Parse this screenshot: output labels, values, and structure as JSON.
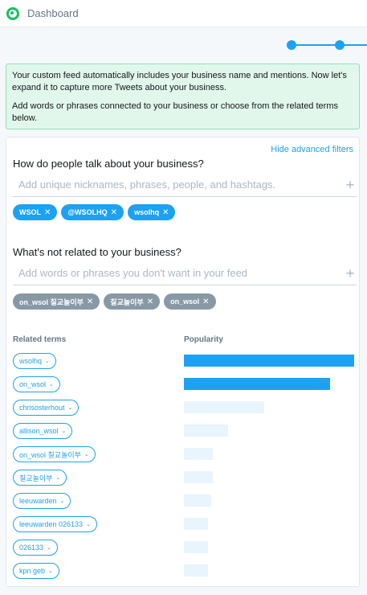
{
  "app": {
    "title": "Dashboard",
    "accent": "#1da1f2",
    "brand": "#17bf63"
  },
  "info": {
    "line1": "Your custom feed automatically includes your business name and mentions. Now let's expand it to capture more Tweets about your business.",
    "line2": "Add words or phrases connected to your business or choose from the related terms below."
  },
  "card": {
    "advanced_link": "Hide advanced filters",
    "include": {
      "question": "How do people talk about your business?",
      "placeholder": "Add unique nicknames, phrases, people, and hashtags.",
      "tags": [
        "WSOL",
        "@WSOLHQ",
        "wsolhq"
      ]
    },
    "exclude": {
      "question": "What's not related to your business?",
      "placeholder": "Add words or phrases you don't want in your feed",
      "tags": [
        "on_wsol 칠교놀이부",
        "칠교놀이부",
        "on_wsol"
      ]
    },
    "related": {
      "terms_header": "Related terms",
      "popularity_header": "Popularity",
      "items": [
        {
          "term": "wsolhq",
          "popularity": 1.0
        },
        {
          "term": "on_wsol",
          "popularity": 0.86
        },
        {
          "term": "chrisosterhout",
          "popularity": 0.47
        },
        {
          "term": "allison_wsol",
          "popularity": 0.26
        },
        {
          "term": "on_wsol 칠교놀이부",
          "popularity": 0.17
        },
        {
          "term": "칠교놀이부",
          "popularity": 0.17
        },
        {
          "term": "leeuwarden",
          "popularity": 0.16
        },
        {
          "term": "leeuwarden 026133",
          "popularity": 0.14
        },
        {
          "term": "026133",
          "popularity": 0.14
        },
        {
          "term": "kpn geb",
          "popularity": 0.14
        }
      ]
    }
  }
}
